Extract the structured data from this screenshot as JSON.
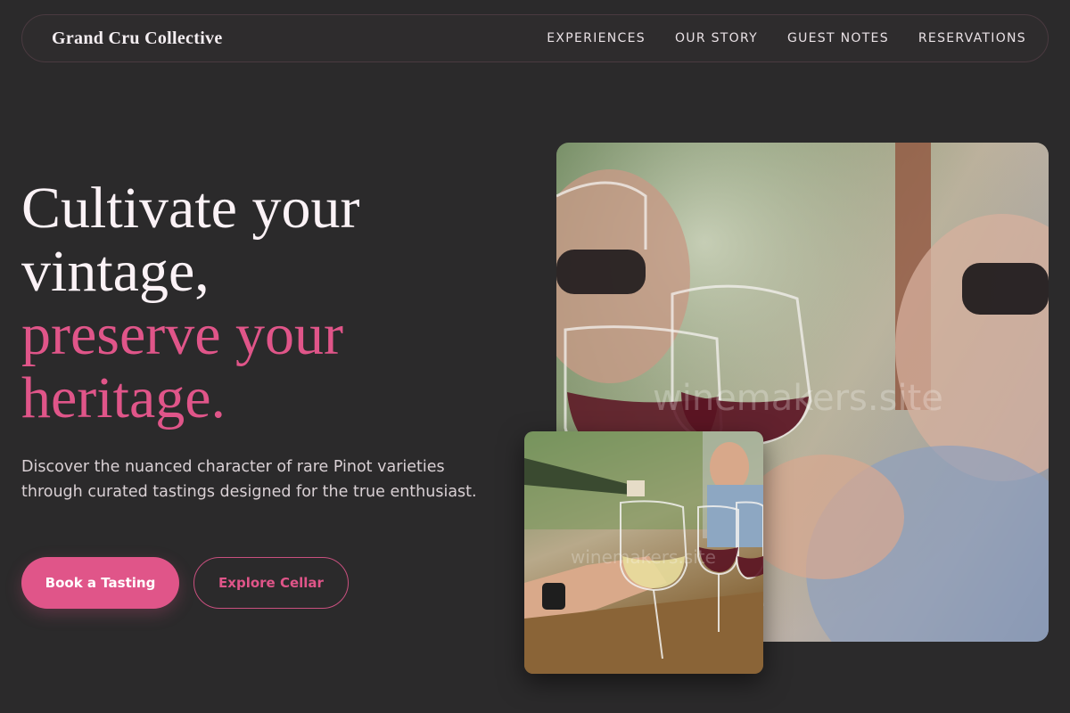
{
  "brand": "Grand Cru Collective",
  "nav": {
    "links": [
      "EXPERIENCES",
      "OUR STORY",
      "GUEST NOTES",
      "RESERVATIONS"
    ]
  },
  "hero": {
    "line1": "Cultivate your",
    "line2": "vintage,",
    "line3": "preserve your",
    "line4": "heritage.",
    "description": "Discover the nuanced character of rare Pinot varieties through curated tastings designed for the true enthusiast.",
    "primary_cta": "Book a Tasting",
    "secondary_cta": "Explore Cellar"
  },
  "images": {
    "main_alt": "Guests raising glasses of red wine in a toast",
    "small_alt": "Wine being poured into glasses at a tasting table",
    "watermark": "winemakers.site"
  },
  "colors": {
    "background": "#2b2a2b",
    "accent": "#e05589",
    "text": "#fbf2f6"
  }
}
